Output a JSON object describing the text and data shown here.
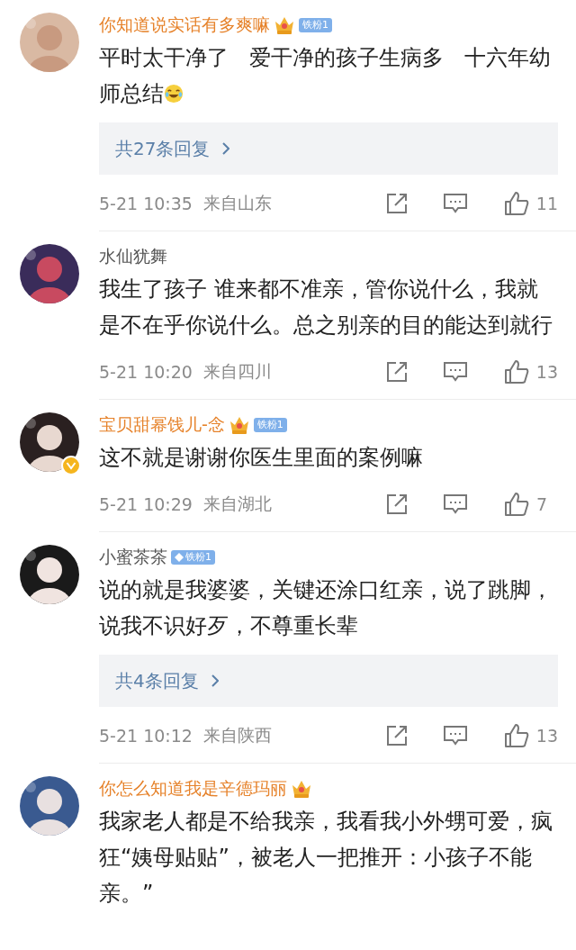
{
  "comments": [
    {
      "name": "你知道说实话有多爽嘛",
      "vip": true,
      "crown": true,
      "fan_badge": {
        "kind": "crown",
        "label": "铁粉1"
      },
      "verified": false,
      "body": "平时太干净了   爱干净的孩子生病多   十六年幼师总结",
      "emoji": true,
      "replies": "共27条回复",
      "time": "5-21 10:35",
      "location": "来自山东",
      "likes": "11"
    },
    {
      "name": "水仙犹舞",
      "vip": false,
      "crown": false,
      "verified": false,
      "body": "我生了孩子 谁来都不准亲，管你说什么，我就是不在乎你说什么。总之别亲的目的能达到就行",
      "emoji": false,
      "time": "5-21 10:20",
      "location": "来自四川",
      "likes": "13"
    },
    {
      "name": "宝贝甜幂饯儿-念",
      "vip": true,
      "crown": true,
      "fan_badge": {
        "kind": "crown",
        "label": "铁粉1"
      },
      "verified": true,
      "body": "这不就是谢谢你医生里面的案例嘛",
      "emoji": false,
      "time": "5-21 10:29",
      "location": "来自湖北",
      "likes": "7"
    },
    {
      "name": "小蜜茶茶",
      "vip": false,
      "crown": false,
      "fan_badge": {
        "kind": "diamond",
        "label": "铁粉1"
      },
      "verified": false,
      "body": "说的就是我婆婆，关键还涂口红亲，说了跳脚，说我不识好歹，不尊重长辈",
      "emoji": false,
      "replies": "共4条回复",
      "time": "5-21 10:12",
      "location": "来自陕西",
      "likes": "13"
    },
    {
      "name": "你怎么知道我是辛德玛丽",
      "vip": true,
      "crown": true,
      "verified": false,
      "body": "我家老人都是不给我亲，我看我小外甥可爱，疯狂“姨母贴贴”，被老人一把推开：小孩子不能亲。”",
      "emoji": false
    }
  ]
}
